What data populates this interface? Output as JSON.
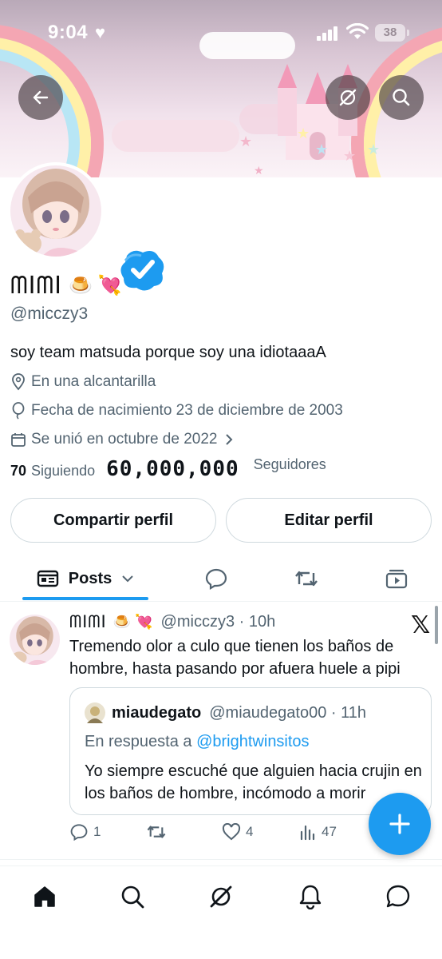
{
  "status_bar": {
    "time": "9:04",
    "heart": "♥",
    "battery": "38"
  },
  "profile": {
    "name": "ᗰIᗰI",
    "name_emoji": "🍮 💘",
    "handle": "@micczy3",
    "bio": "soy team matsuda porque soy una idiotaaaA",
    "location": "En una alcantarilla",
    "birth": "Fecha de nacimiento 23 de diciembre de 2003",
    "joined": "Se unió en octubre de 2022",
    "following_count": "70",
    "following_label": "Siguiendo",
    "followers_count": "60,000,000",
    "followers_label": "Seguidores",
    "verified_color": "#1d9bf0"
  },
  "buttons": {
    "share": "Compartir perfil",
    "edit": "Editar perfil"
  },
  "tabs": {
    "posts": "Posts",
    "icons": [
      "replies-icon",
      "reposts-icon",
      "media-icon"
    ]
  },
  "post": {
    "name": "ᗰIᗰI",
    "emoji": "🍮 💘",
    "handle_time": "@micczy3 · 10h",
    "text": "Tremendo olor a culo que tienen los baños de hombre, hasta pasando por afuera huele a pipi",
    "quote": {
      "name": "miaudegato",
      "handle_time": "@miaudegato00 · 11h",
      "reply_prefix": "En respuesta a ",
      "reply_to": "@brightwinsitos",
      "text": "Yo siempre escuché que alguien hacia crujin en los baños de hombre, incómodo a morir"
    },
    "stats": {
      "replies": "1",
      "likes": "4",
      "views": "47"
    }
  },
  "colors": {
    "accent": "#1d9bf0",
    "secondary_text": "#536471",
    "primary_text": "#0f1419"
  }
}
